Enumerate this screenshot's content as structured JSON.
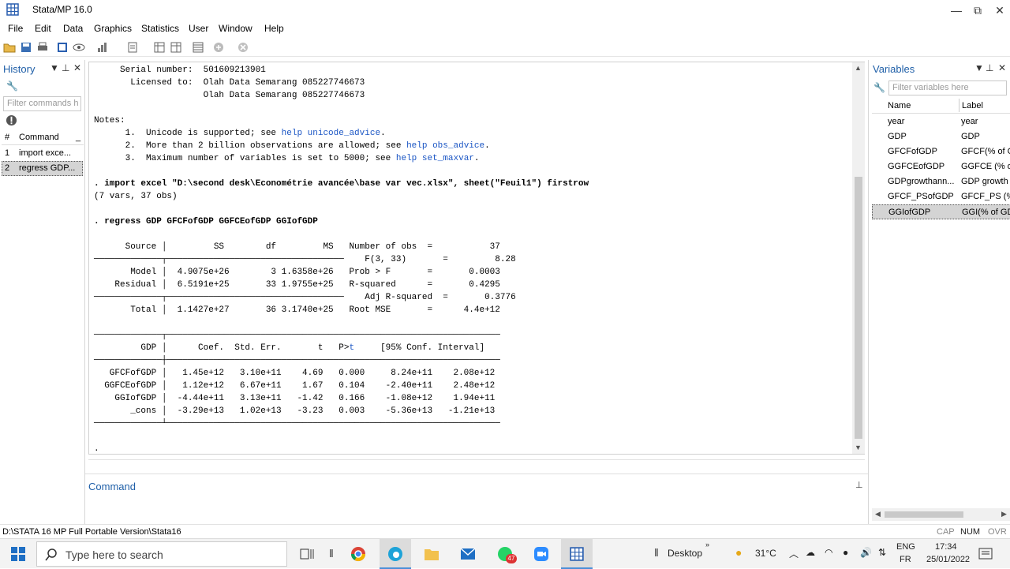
{
  "window": {
    "title": "Stata/MP 16.0",
    "minimize": "—",
    "restore": "⧉",
    "close": "✕"
  },
  "menu": [
    "File",
    "Edit",
    "Data",
    "Graphics",
    "Statistics",
    "User",
    "Window",
    "Help"
  ],
  "history": {
    "title": "History",
    "filter_placeholder": "Filter commands h",
    "col_num": "#",
    "col_command": "Command",
    "col_extra": "_",
    "rows": [
      {
        "num": "1",
        "cmd": "import exce..."
      },
      {
        "num": "2",
        "cmd": "regress GDP..."
      }
    ]
  },
  "results": {
    "header": [
      "     Serial number:  501609213901",
      "       Licensed to:  Olah Data Semarang 085227746673",
      "                     Olah Data Semarang 085227746673",
      "",
      "Notes:",
      "      1.  Unicode is supported; see |help unicode_advice|.",
      "      2.  More than 2 billion observations are allowed; see |help obs_advice|.",
      "      3.  Maximum number of variables is set to 5000; see |help set_maxvar|.",
      ""
    ],
    "import_cmd": ". import excel \"D:\\second desk\\Econométrie avancée\\base var vec.xlsx\", sheet(\"Feuil1\") firstrow",
    "import_result": "(7 vars, 37 obs)",
    "regress_cmd": ". regress GDP GFCFofGDP GGFCEofGDP GGIofGDP",
    "anova": {
      "headers": [
        "Source",
        "SS",
        "df",
        "MS"
      ],
      "rows": [
        {
          "source": "Model",
          "ss": "4.9075e+26",
          "df": "3",
          "ms": "1.6358e+26"
        },
        {
          "source": "Residual",
          "ss": "6.5191e+25",
          "df": "33",
          "ms": "1.9755e+25"
        },
        {
          "source": "Total",
          "ss": "1.1427e+27",
          "df": "36",
          "ms": "3.1740e+25"
        }
      ]
    },
    "fit": [
      {
        "label": "Number of obs",
        "value": "37"
      },
      {
        "label": "F(3, 33)",
        "value": "8.28"
      },
      {
        "label": "Prob > F",
        "value": "0.0003"
      },
      {
        "label": "R-squared",
        "value": "0.4295"
      },
      {
        "label": "Adj R-squared",
        "value": "0.3776"
      },
      {
        "label": "Root MSE",
        "value": "4.4e+12"
      }
    ],
    "coef_headers": [
      "GDP",
      "Coef.",
      "Std. Err.",
      "t",
      "P>|t|",
      "[95% Conf. Interval]"
    ],
    "coef_rows": [
      {
        "var": "GFCFofGDP",
        "coef": "1.45e+12",
        "se": "3.10e+11",
        "t": "4.69",
        "p": "0.000",
        "lo": "8.24e+11",
        "hi": "2.08e+12"
      },
      {
        "var": "GGFCEofGDP",
        "coef": "1.12e+12",
        "se": "6.67e+11",
        "t": "1.67",
        "p": "0.104",
        "lo": "-2.40e+11",
        "hi": "2.48e+12"
      },
      {
        "var": "GGIofGDP",
        "coef": "-4.44e+11",
        "se": "3.13e+11",
        "t": "-1.42",
        "p": "0.166",
        "lo": "-1.08e+12",
        "hi": "1.94e+11"
      },
      {
        "var": "_cons",
        "coef": "-3.29e+13",
        "se": "1.02e+13",
        "t": "-3.23",
        "p": "0.003",
        "lo": "-5.36e+13",
        "hi": "-1.21e+13"
      }
    ],
    "prompt": "."
  },
  "command_pane": {
    "title": "Command"
  },
  "variables": {
    "title": "Variables",
    "filter_placeholder": "Filter variables here",
    "col_name": "Name",
    "col_label": "Label",
    "rows": [
      {
        "name": "year",
        "label": "year"
      },
      {
        "name": "GDP",
        "label": "GDP"
      },
      {
        "name": "GFCFofGDP",
        "label": "GFCF(% of G"
      },
      {
        "name": "GGFCEofGDP",
        "label": "GGFCE (% o"
      },
      {
        "name": "GDPgrowthann...",
        "label": "GDP growth"
      },
      {
        "name": "GFCF_PSofGDP",
        "label": "GFCF_PS (%"
      },
      {
        "name": "GGIofGDP",
        "label": "GGI(% of GD"
      }
    ]
  },
  "statusbar": {
    "path": "D:\\STATA 16 MP Full Portable Version\\Stata16",
    "cap": "CAP",
    "num": "NUM",
    "ovr": "OVR"
  },
  "taskbar": {
    "search_placeholder": "Type here to search",
    "desktop": "Desktop",
    "temp": "31°C",
    "lang1": "ENG",
    "lang2": "FR",
    "time": "17:34",
    "date": "25/01/2022",
    "badge": "47"
  },
  "colors": {
    "accent": "#1f5fa8",
    "link": "#1a55c4",
    "selection": "#cde4f7"
  }
}
